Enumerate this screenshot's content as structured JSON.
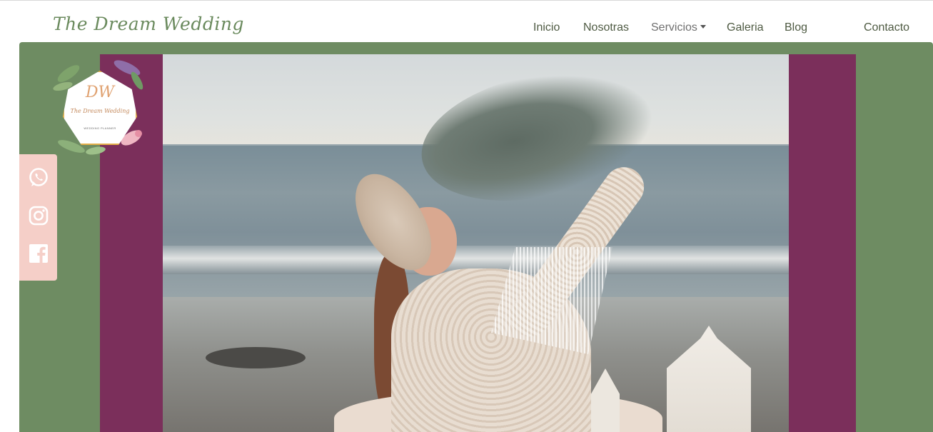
{
  "brand": {
    "name": "The Dream Wedding"
  },
  "nav": {
    "items": [
      {
        "label": "Inicio"
      },
      {
        "label": "Nosotras"
      },
      {
        "label": "Servicios"
      },
      {
        "label": "Galeria"
      },
      {
        "label": "Blog"
      },
      {
        "label": "Contacto"
      }
    ]
  },
  "logo": {
    "monogram": "DW",
    "name": "The Dream Wedding",
    "subtitle": "WEDDING PLANNER"
  },
  "social": {
    "icons": [
      "whatsapp-icon",
      "instagram-icon",
      "facebook-icon"
    ]
  },
  "colors": {
    "hero_green": "#6e8c62",
    "frame_plum": "#7b2f5b",
    "social_pink": "#f5cfc8",
    "brand_green": "#6a8a5d"
  }
}
